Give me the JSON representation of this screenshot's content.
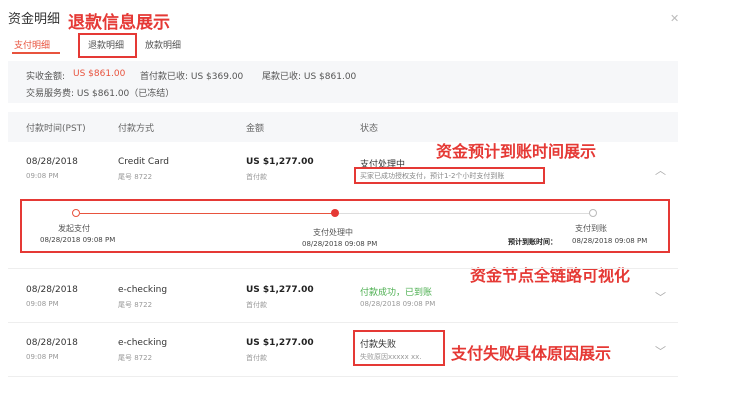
{
  "header": {
    "title": "资金明细",
    "close_icon": "close-icon"
  },
  "tabs": [
    {
      "label": "支付明细",
      "active": true
    },
    {
      "label": "退款明细",
      "active": false
    },
    {
      "label": "放款明细",
      "active": false
    }
  ],
  "annotations": {
    "refund_info": "退款信息展示",
    "arrival_time": "资金预计到账时间展示",
    "chain_visual": "资金节点全链路可视化",
    "fail_reason": "支付失败具体原因展示"
  },
  "summary": {
    "received_label": "实收金额:",
    "received_value": "US $861.00",
    "first_label": "首付款已收: US $369.00",
    "final_label": "尾款已收: US $861.00",
    "fee_label": "交易服务费: US $861.00（已冻结）"
  },
  "table": {
    "headers": [
      "付款时间(PST)",
      "付款方式",
      "金额",
      "状态"
    ]
  },
  "rows": [
    {
      "date": "08/28/2018",
      "time": "09:08 PM",
      "method": "Credit Card",
      "tail": "尾号 8722",
      "amount": "US $1,277.00",
      "amount_sub": "首付款",
      "status": "支付处理中",
      "status_note": "买家已成功授权支付，预计1-2个小时支付到账"
    },
    {
      "date": "08/28/2018",
      "time": "09:08 PM",
      "method": "e-checking",
      "tail": "尾号 8722",
      "amount": "US $1,277.00",
      "amount_sub": "首付款",
      "status": "付款成功，已到账",
      "status_note": "08/28/2018 09:08 PM"
    },
    {
      "date": "08/28/2018",
      "time": "09:08 PM",
      "method": "e-checking",
      "tail": "尾号 8722",
      "amount": "US $1,277.00",
      "amount_sub": "首付款",
      "status": "付款失败",
      "status_note": "失败原因xxxxx xx."
    }
  ],
  "timeline": {
    "nodes": [
      {
        "label": "发起支付",
        "date": "08/28/2018 09:08 PM"
      },
      {
        "label": "支付处理中",
        "date": "08/28/2018 09:08 PM"
      },
      {
        "label": "支付到账",
        "date": "08/28/2018 09:08 PM",
        "prefix": "预计到账时间："
      }
    ]
  },
  "colors": {
    "accent": "#e8533e",
    "annotation": "#e53935",
    "success": "#4caf50"
  }
}
